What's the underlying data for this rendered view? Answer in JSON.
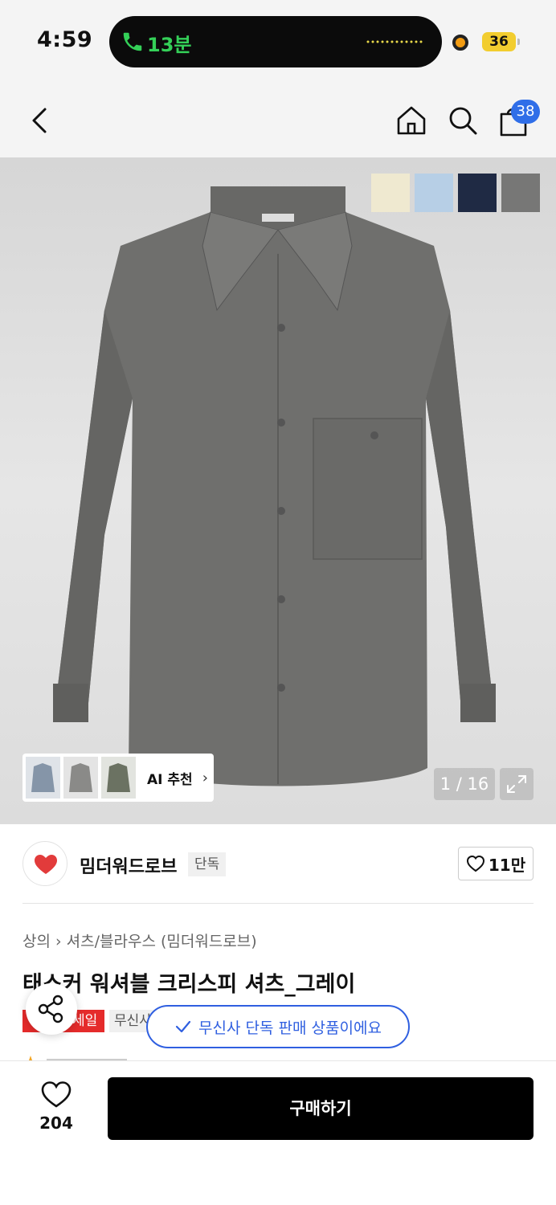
{
  "status_bar": {
    "time": "4:59",
    "call_duration": "13분",
    "battery": "36",
    "colors": {
      "call_green": "#34d058",
      "recording": "#f39c12",
      "battery_yellow": "#f2cd2f"
    }
  },
  "nav": {
    "icons": [
      "back-arrow-icon",
      "home-icon",
      "search-icon",
      "shopping-bag-icon"
    ],
    "cart_count": "38"
  },
  "gallery": {
    "color_swatches": [
      "#efe9d0",
      "#b7cfe6",
      "#1f2a44",
      "#777776"
    ],
    "ai_recommend_label": "AI 추천",
    "image_counter": "1 / 16"
  },
  "brand": {
    "name": "밈더워드로브",
    "badge": "단독",
    "likes": "11만"
  },
  "product": {
    "breadcrumb": [
      "상의",
      "셔츠/블라우스 (밈더워드로브)"
    ],
    "title": "태스커 워셔블 크리스피 셔츠_그레이",
    "tag_sale": "세일",
    "tag_musinsa": "무신사",
    "toast": "무신사 단독 판매 상품이에요"
  },
  "bottom_bar": {
    "wish_count": "204",
    "buy_label": "구매하기",
    "colors": {
      "buy_button": "#000000",
      "accent_blue": "#2f5fe0",
      "sale_red": "#e52b2b"
    }
  }
}
